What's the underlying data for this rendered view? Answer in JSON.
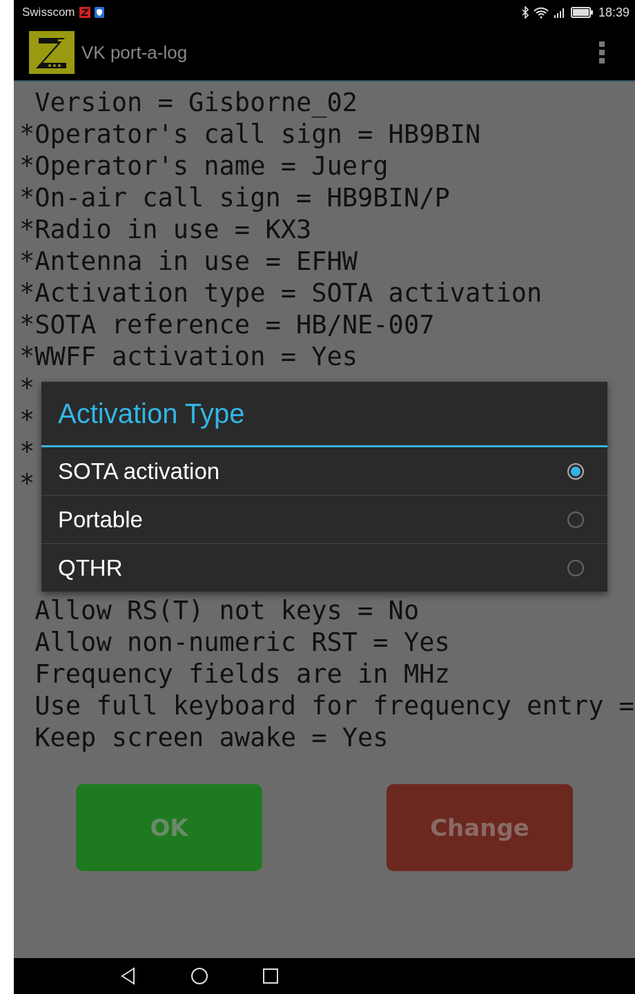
{
  "status_bar": {
    "carrier": "Swisscom",
    "time": "18:39"
  },
  "app_bar": {
    "title": "VK port-a-log"
  },
  "settings_lines_top": [
    " Version = Gisborne_02",
    "*Operator's call sign = HB9BIN",
    "*Operator's name = Juerg",
    "*On-air call sign = HB9BIN/P",
    "*Radio in use = KX3",
    "*Antenna in use = EFHW",
    "*Activation type = SOTA activation",
    "*SOTA reference = HB/NE-007",
    "*WWFF activation = Yes"
  ],
  "settings_lines_covered": [
    "*",
    "*",
    "*",
    "*"
  ],
  "settings_lines_bottom": [
    " Allow RS(T) not keys = No",
    " Allow non-numeric RST = Yes",
    " Frequency fields are in MHz",
    " Use full keyboard for frequency entry =",
    " Keep screen awake = Yes"
  ],
  "buttons": [
    {
      "label": "OK",
      "kind": "ok"
    },
    {
      "label": "Change",
      "kind": "change"
    }
  ],
  "dialog": {
    "title": "Activation Type",
    "options": [
      {
        "label": "SOTA activation",
        "selected": true
      },
      {
        "label": "Portable",
        "selected": false
      },
      {
        "label": "QTHR",
        "selected": false
      }
    ]
  }
}
